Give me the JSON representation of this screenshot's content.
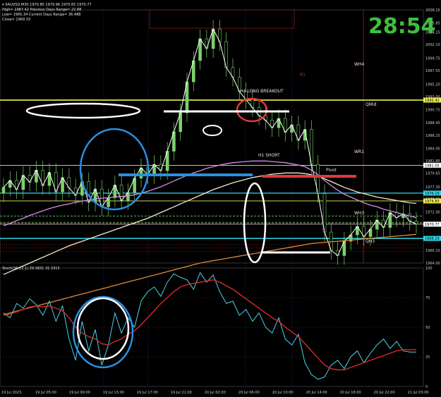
{
  "header": {
    "symbol_line": "▾ XAUUSD,M30  1970.85 1979.96 1970.65 1970.77",
    "high_line": "High= 1987.42   Previous Days Range= 22.88",
    "low_line": "Low= 1965.34   Current Days Range= 36.488",
    "close_line": "Close= 1969.33"
  },
  "timer": "28:54",
  "stoch_label": "Stoch(36,12,1) 29.3831 31.3315",
  "annotations": {
    "h4_breakout": "H4 LONG BREAKOUT",
    "h1_short": "H1 SHORT",
    "pivot": "Pivot",
    "wh4": "WH4",
    "qmid": "QMid",
    "wr1": "WR1",
    "wh3": "WH3",
    "qh3": "QH3",
    "r1": "R1"
  },
  "colors": {
    "background": "#000000",
    "candles": "#7bd16b",
    "price_line": "#ffffff",
    "ma_violet": "#d58be6",
    "ma_orange": "#e08a3a",
    "ma_cream": "#f5e9c9",
    "stoch_main": "#4ad3e8",
    "stoch_signal": "#d42a2a",
    "yellow_level": "#f0f050",
    "cyan_level": "#2fd7e8",
    "blue_ellipse": "#2a8fe0",
    "red_ellipse": "#e03a3a"
  },
  "chart_data": [
    {
      "type": "line",
      "panel": "price",
      "ylim": [
        1964.0,
        2008.15
      ],
      "y_ticks": [
        "2008.15",
        "2005.85",
        "2004.25",
        "2002.10",
        "1999.75",
        "1997.55",
        "1995.20",
        "1993.00",
        "1990.75",
        "1988.45",
        "1986.25",
        "1984.00",
        "1981.85",
        "1979.65",
        "1977.30",
        "1975.20",
        "1972.90",
        "1970.65",
        "1968.40",
        "1966.20",
        "1964.00"
      ],
      "x_ticks": [
        "19 Jul 2023",
        "19 Jul 05:00",
        "19 Jul 09:00",
        "19 Jul 13:00",
        "19 Jul 17:00",
        "19 Jul 21:00",
        "20 Jul 02:00",
        "20 Jul 06:00",
        "20 Jul 10:00",
        "20 Jul 14:00",
        "20 Jul 18:00",
        "20 Jul 22:00",
        "21 Jul 03:00"
      ],
      "price_labels": [
        {
          "name": "wh4",
          "value": "1992.42",
          "color": "#f0f050"
        },
        {
          "name": "level",
          "value": "1981.05",
          "color": "#ffffff"
        },
        {
          "name": "wr1",
          "value": "1976.19",
          "color": "#2fd7e8"
        },
        {
          "name": "pivot",
          "value": "1974.83",
          "color": "#f0f050"
        },
        {
          "name": "current",
          "value": "1970.77",
          "color": "#ffffff"
        },
        {
          "name": "wh3",
          "value": "1968.29",
          "color": "#2fd7e8"
        }
      ],
      "series": [
        {
          "key": "close",
          "values": [
            1977.2,
            1978.4,
            1976.8,
            1979.3,
            1978.1,
            1980.2,
            1977.5,
            1979.8,
            1976.4,
            1978.9,
            1977.1,
            1975.8,
            1978.2,
            1974.6,
            1976.9,
            1973.8,
            1975.4,
            1977.6,
            1974.9,
            1976.3,
            1978.8,
            1980.6,
            1979.4,
            1981.2,
            1980.1,
            1983.5,
            1986.9,
            1990.2,
            1995.6,
            1999.3,
            2003.1,
            2001.4,
            2004.8,
            2002.6,
            1998.1,
            1996.4,
            1993.9,
            1992.5,
            1991.1,
            1989.7,
            1988.9,
            1987.6,
            1989.2,
            1986.8,
            1988.1,
            1985.4,
            1987.3,
            1981.2,
            1976.1,
            1969.4,
            1966.2,
            1965.3,
            1967.8,
            1968.9,
            1970.4,
            1968.6,
            1969.9,
            1971.5,
            1970.2,
            1972.8,
            1971.9,
            1972.6,
            1971.3,
            1970.8
          ]
        },
        {
          "key": "ma_violet",
          "values": [
            1970.5,
            1970.9,
            1971.4,
            1971.8,
            1972.3,
            1972.7,
            1973.1,
            1973.5,
            1973.8,
            1974.1,
            1974.3,
            1974.6,
            1974.8,
            1975.0,
            1975.2,
            1975.3,
            1975.4,
            1975.5,
            1975.6,
            1975.7,
            1975.9,
            1976.2,
            1976.5,
            1976.9,
            1977.3,
            1977.8,
            1978.3,
            1978.8,
            1979.3,
            1979.7,
            1980.1,
            1980.5,
            1980.8,
            1981.1,
            1981.3,
            1981.5,
            1981.6,
            1981.7,
            1981.8,
            1981.8,
            1981.8,
            1981.7,
            1981.6,
            1981.5,
            1981.3,
            1981.1,
            1980.8,
            1980.2,
            1979.4,
            1978.4,
            1977.5,
            1976.7,
            1976.0,
            1975.5,
            1975.0,
            1974.5,
            1974.1,
            1973.8,
            1973.4,
            1973.1,
            1972.8,
            1972.5,
            1972.2,
            1971.9
          ]
        },
        {
          "key": "ma_cream",
          "values": [
            1962.0,
            1962.5,
            1963.0,
            1963.5,
            1964.0,
            1964.5,
            1965.0,
            1965.5,
            1966.0,
            1966.5,
            1967.0,
            1967.4,
            1967.8,
            1968.2,
            1968.6,
            1969.0,
            1969.4,
            1969.8,
            1970.2,
            1970.6,
            1971.0,
            1971.4,
            1971.8,
            1972.3,
            1972.8,
            1973.3,
            1973.8,
            1974.3,
            1974.8,
            1975.3,
            1975.8,
            1976.3,
            1976.8,
            1977.2,
            1977.6,
            1978.0,
            1978.3,
            1978.6,
            1978.9,
            1979.1,
            1979.3,
            1979.5,
            1979.6,
            1979.7,
            1979.7,
            1979.7,
            1979.6,
            1979.4,
            1979.1,
            1978.7,
            1978.2,
            1977.7,
            1977.2,
            1976.8,
            1976.4,
            1976.1,
            1975.8,
            1975.5,
            1975.3,
            1975.1,
            1974.9,
            1974.7,
            1974.5,
            1974.4
          ]
        },
        {
          "key": "ma_orange",
          "values": [
            1955.0,
            1955.3,
            1955.6,
            1955.9,
            1956.2,
            1956.5,
            1956.8,
            1957.1,
            1957.4,
            1957.7,
            1958.0,
            1958.3,
            1958.6,
            1958.9,
            1959.2,
            1959.5,
            1959.8,
            1960.1,
            1960.4,
            1960.7,
            1961.0,
            1961.3,
            1961.6,
            1961.9,
            1962.2,
            1962.5,
            1962.8,
            1963.1,
            1963.4,
            1963.7,
            1964.0,
            1964.2,
            1964.4,
            1964.6,
            1964.8,
            1965.0,
            1965.2,
            1965.4,
            1965.6,
            1965.8,
            1966.0,
            1966.2,
            1966.4,
            1966.6,
            1966.8,
            1967.0,
            1967.2,
            1967.4,
            1967.5,
            1967.6,
            1967.7,
            1967.8,
            1967.9,
            1968.0,
            1968.1,
            1968.2,
            1968.3,
            1968.4,
            1968.5,
            1968.6,
            1968.7,
            1968.8,
            1968.9,
            1969.0
          ]
        }
      ],
      "levels": [
        {
          "name": "wh4",
          "value": 1992.42,
          "color": "#f0f050",
          "width": 1.6
        },
        {
          "name": "level-white",
          "value": 1981.05,
          "color": "#ffffff",
          "width": 0.8
        },
        {
          "name": "wr1",
          "value": 1976.19,
          "color": "#2fd7e8",
          "width": 1.2
        },
        {
          "name": "pivot",
          "value": 1974.83,
          "color": "#f0f050",
          "width": 0.8
        },
        {
          "name": "green-dash-1",
          "value": 1972.2,
          "color": "#6fd16f",
          "width": 0.8,
          "dash": "3,2"
        },
        {
          "name": "green-dash-2",
          "value": 1971.1,
          "color": "#6fd16f",
          "width": 0.8,
          "dash": "3,2"
        },
        {
          "name": "red-dash",
          "value": 1970.9,
          "color": "#e03a3a",
          "width": 0.8,
          "dash": "3,2"
        },
        {
          "name": "current",
          "value": 1970.77,
          "color": "#ffffff",
          "width": 0.6
        },
        {
          "name": "wh3",
          "value": 1968.29,
          "color": "#2fd7e8",
          "width": 1.6
        },
        {
          "name": "red-dot-1",
          "value": 1967.2,
          "color": "#c03030",
          "width": 0.6,
          "dash": "1,2"
        },
        {
          "name": "red-dot-2",
          "value": 1966.6,
          "color": "#c03030",
          "width": 0.6,
          "dash": "1,2"
        },
        {
          "name": "red-dot-3",
          "value": 1966.0,
          "color": "#c03030",
          "width": 0.6,
          "dash": "1,2"
        }
      ]
    },
    {
      "type": "line",
      "panel": "stochastic",
      "ylim": [
        0,
        100
      ],
      "y_ticks": [
        "100",
        "75",
        "50",
        "25",
        "0"
      ],
      "series": [
        {
          "key": "main",
          "values": [
            62,
            58,
            70,
            66,
            74,
            69,
            60,
            72,
            55,
            68,
            40,
            22,
            55,
            30,
            48,
            18,
            35,
            62,
            45,
            58,
            50,
            72,
            80,
            84,
            76,
            88,
            95,
            92,
            90,
            82,
            96,
            88,
            94,
            80,
            70,
            72,
            60,
            65,
            55,
            62,
            50,
            45,
            58,
            40,
            35,
            44,
            20,
            10,
            6,
            8,
            18,
            22,
            15,
            25,
            30,
            20,
            28,
            35,
            40,
            32,
            38,
            30,
            29,
            29
          ]
        },
        {
          "key": "signal",
          "values": [
            60,
            61,
            63,
            65,
            67,
            68,
            67,
            68,
            66,
            64,
            58,
            50,
            45,
            42,
            40,
            36,
            35,
            38,
            40,
            44,
            47,
            52,
            58,
            64,
            70,
            75,
            80,
            84,
            86,
            87,
            88,
            89,
            90,
            88,
            85,
            82,
            78,
            74,
            70,
            66,
            62,
            58,
            55,
            50,
            46,
            42,
            36,
            30,
            24,
            18,
            15,
            14,
            14,
            16,
            18,
            20,
            22,
            24,
            26,
            28,
            30,
            31,
            31,
            31
          ]
        }
      ]
    }
  ]
}
